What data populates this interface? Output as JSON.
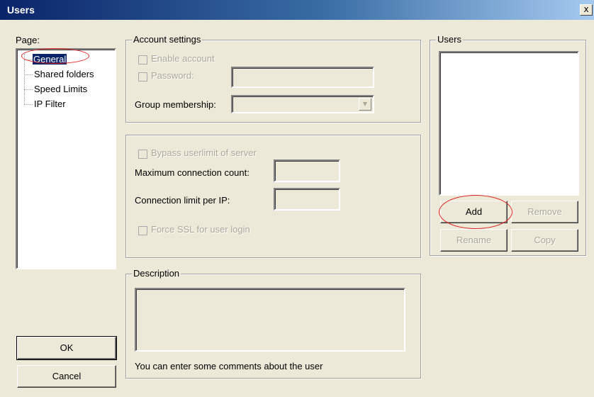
{
  "window": {
    "title": "Users",
    "close_glyph": "x"
  },
  "page_panel": {
    "label": "Page:",
    "items": [
      {
        "label": "General",
        "selected": true
      },
      {
        "label": "Shared folders"
      },
      {
        "label": "Speed Limits"
      },
      {
        "label": "IP Filter"
      }
    ]
  },
  "account": {
    "legend": "Account settings",
    "enable_label": "Enable account",
    "password_label": "Password:",
    "password_value": "",
    "group_label": "Group membership:",
    "group_value": ""
  },
  "limits": {
    "bypass_label": "Bypass userlimit of server",
    "max_conn_label": "Maximum connection count:",
    "max_conn_value": "",
    "conn_ip_label": "Connection limit per IP:",
    "conn_ip_value": "",
    "ssl_label": "Force SSL for user login"
  },
  "description": {
    "legend": "Description",
    "value": "",
    "hint": "You can enter some comments about the user"
  },
  "users": {
    "legend": "Users",
    "add_label": "Add",
    "remove_label": "Remove",
    "rename_label": "Rename",
    "copy_label": "Copy"
  },
  "buttons": {
    "ok": "OK",
    "cancel": "Cancel"
  },
  "colors": {
    "annotation": "#e02020",
    "selection": "#0a246a",
    "face": "#ece9d8"
  }
}
